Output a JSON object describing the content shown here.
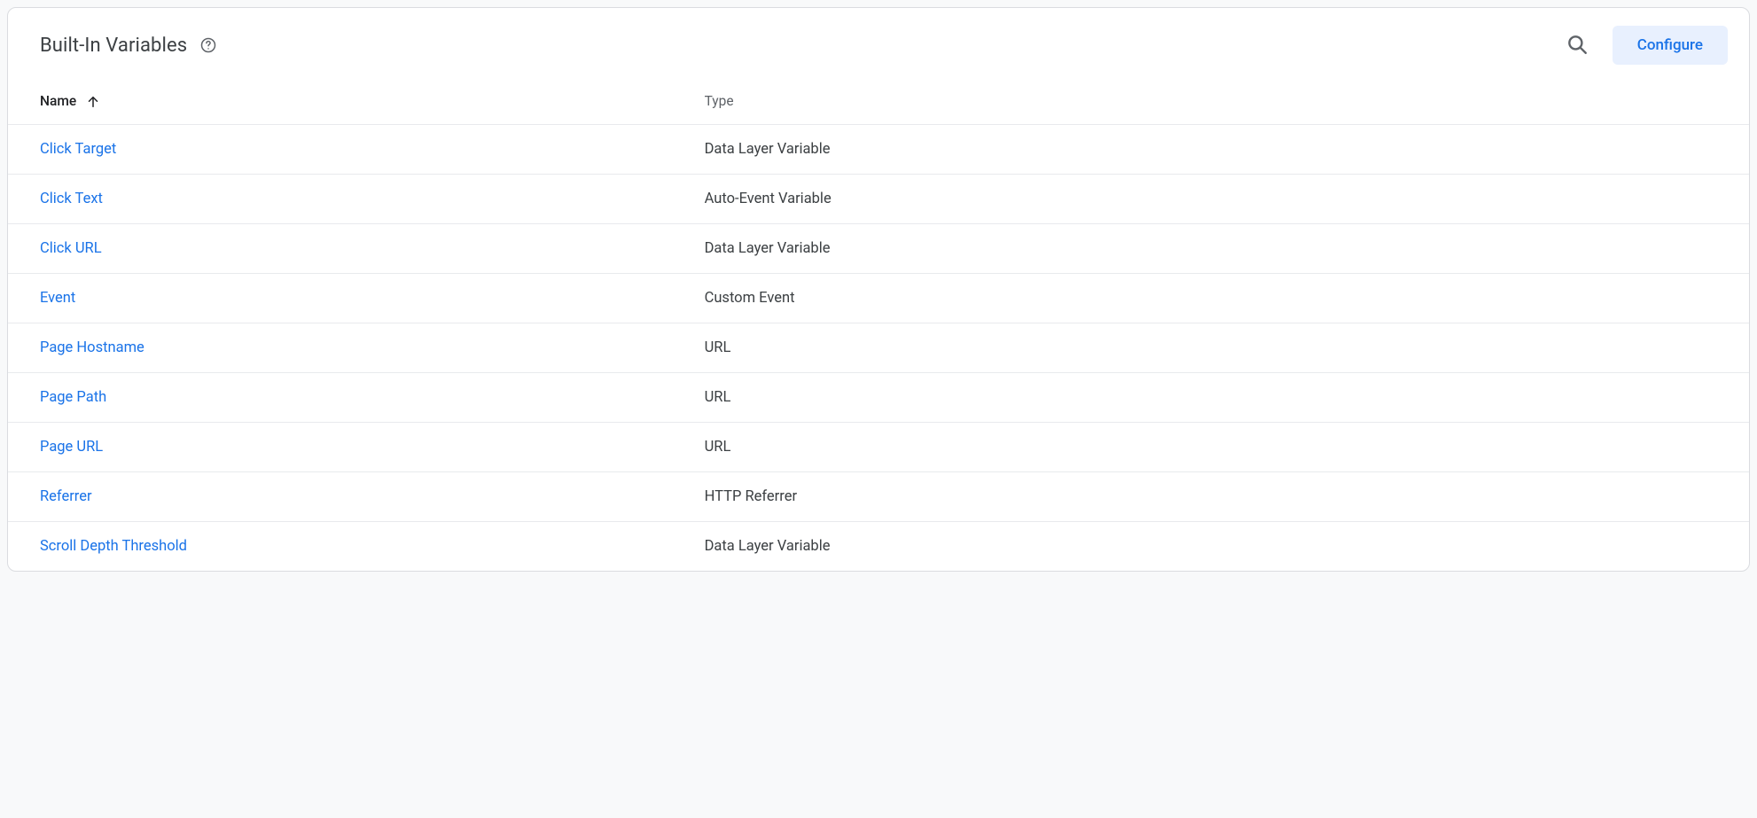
{
  "header": {
    "title": "Built-In Variables",
    "configure_label": "Configure"
  },
  "table": {
    "columns": {
      "name": "Name",
      "type": "Type"
    },
    "rows": [
      {
        "name": "Click Target",
        "type": "Data Layer Variable"
      },
      {
        "name": "Click Text",
        "type": "Auto-Event Variable"
      },
      {
        "name": "Click URL",
        "type": "Data Layer Variable"
      },
      {
        "name": "Event",
        "type": "Custom Event"
      },
      {
        "name": "Page Hostname",
        "type": "URL"
      },
      {
        "name": "Page Path",
        "type": "URL"
      },
      {
        "name": "Page URL",
        "type": "URL"
      },
      {
        "name": "Referrer",
        "type": "HTTP Referrer"
      },
      {
        "name": "Scroll Depth Threshold",
        "type": "Data Layer Variable"
      }
    ]
  }
}
